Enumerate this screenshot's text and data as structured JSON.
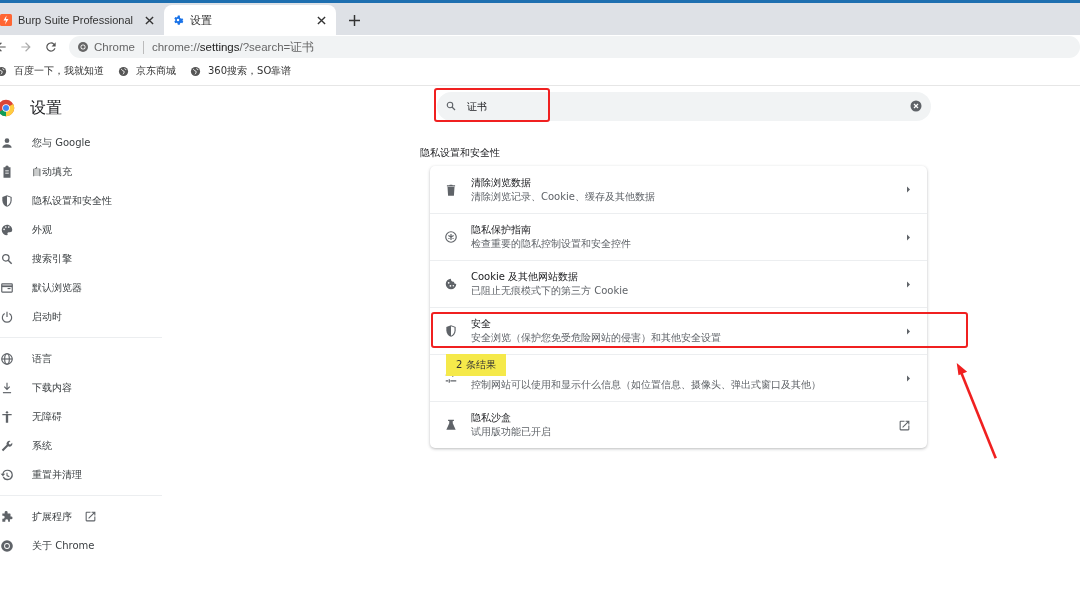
{
  "tabs": [
    {
      "title": "Burp Suite Professional",
      "selected": false
    },
    {
      "title": "设置",
      "selected": true
    }
  ],
  "address_bar": {
    "site_label": "Chrome",
    "url": "chrome://**settings**/?search=证书"
  },
  "bookmarks": [
    "百度一下，我就知道",
    "京东商城",
    "360搜索，SO靠谱"
  ],
  "sidebar": {
    "title": "设置",
    "sections": [
      [
        {
          "label": "您与 Google",
          "external": false
        },
        {
          "label": "自动填充",
          "external": false
        },
        {
          "label": "隐私设置和安全性",
          "external": false
        },
        {
          "label": "外观",
          "external": false
        },
        {
          "label": "搜索引擎",
          "external": false
        },
        {
          "label": "默认浏览器",
          "external": false
        },
        {
          "label": "启动时",
          "external": false
        }
      ],
      [
        {
          "label": "语言",
          "external": false
        },
        {
          "label": "下载内容",
          "external": false
        },
        {
          "label": "无障碍",
          "external": false
        },
        {
          "label": "系统",
          "external": false
        },
        {
          "label": "重置并清理",
          "external": false
        }
      ],
      [
        {
          "label": "扩展程序",
          "external": true
        },
        {
          "label": "关于 Chrome",
          "external": false
        }
      ]
    ]
  },
  "search": {
    "value": "证书",
    "highlighted": true
  },
  "section_title": "隐私设置和安全性",
  "rows": [
    {
      "title": "清除浏览数据",
      "description": "清除浏览记录、Cookie、缓存及其他数据",
      "kind": "arrow",
      "highlighted": false
    },
    {
      "title": "隐私保护指南",
      "description": "检查重要的隐私控制设置和安全控件",
      "kind": "arrow",
      "highlighted": false
    },
    {
      "title": "Cookie 及其他网站数据",
      "description": "已阻止无痕模式下的第三方 Cookie",
      "kind": "arrow",
      "highlighted": false
    },
    {
      "title": "安全",
      "description": "安全浏览（保护您免受危险网站的侵害）和其他安全设置",
      "kind": "arrow",
      "highlighted": true
    },
    {
      "description": "控制网站可以使用和显示什么信息（如位置信息、摄像头、弹出式窗口及其他）",
      "kind": "arrow",
      "highlighted": false
    },
    {
      "title": "隐私沙盒",
      "description": "试用版功能已开启",
      "kind": "external",
      "highlighted": false
    }
  ],
  "result_bubble": {
    "text": "2 条结果"
  }
}
